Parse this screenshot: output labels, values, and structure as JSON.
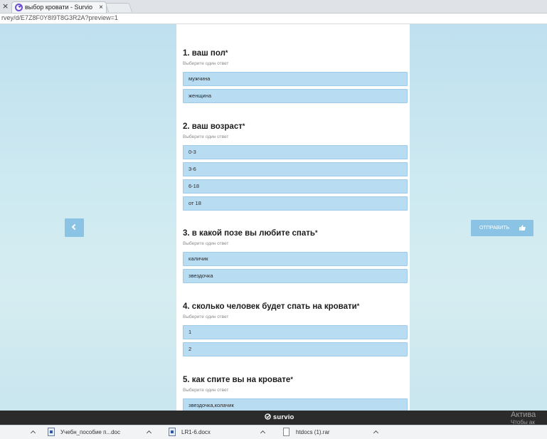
{
  "browser": {
    "tab_close_left": "×",
    "tab_title": "выбор кровати - Survio",
    "tab_close": "×",
    "url": "rvey/d/E7Z8F0Y8I9T8G3R2A?preview=1"
  },
  "survey": {
    "questions": [
      {
        "number": "1.",
        "title": "ваш пол",
        "required": "*",
        "hint": "Выберите один ответ",
        "options": [
          "мужчина",
          "женщина"
        ]
      },
      {
        "number": "2.",
        "title": "ваш возраст",
        "required": "*",
        "hint": "Выберите один ответ",
        "options": [
          "0-3",
          "3-6",
          "6-18",
          "от 18"
        ]
      },
      {
        "number": "3.",
        "title": "в какой позе вы любите спать",
        "required": "*",
        "hint": "Выберите один ответ",
        "options": [
          "каличик",
          "звездочка"
        ]
      },
      {
        "number": "4.",
        "title": "сколько человек будет спать на кровати",
        "required": "*",
        "hint": "Выберите один ответ",
        "options": [
          "1",
          "2"
        ]
      },
      {
        "number": "5.",
        "title": "как спите вы на кровате",
        "required": "*",
        "hint": "Выберите один ответ",
        "options": [
          "звездочка,колачик"
        ]
      }
    ]
  },
  "nav": {
    "prev_icon": "chevron-left-icon",
    "submit_label": "ОТПРАВИТЬ",
    "submit_icon": "thumbs-up-icon"
  },
  "footer": {
    "brand": "survio",
    "activate_line1": "Актива",
    "activate_line2": "Чтобы ак"
  },
  "downloads": {
    "items": [
      {
        "label": "Учебн_пособие п...doc"
      },
      {
        "label": "LR1-6.docx"
      },
      {
        "label": "htdocs (1).rar"
      }
    ]
  },
  "colors": {
    "option_fill": "#b8dcf2",
    "button": "#8bc3e5",
    "footer": "#2b2b2b"
  }
}
